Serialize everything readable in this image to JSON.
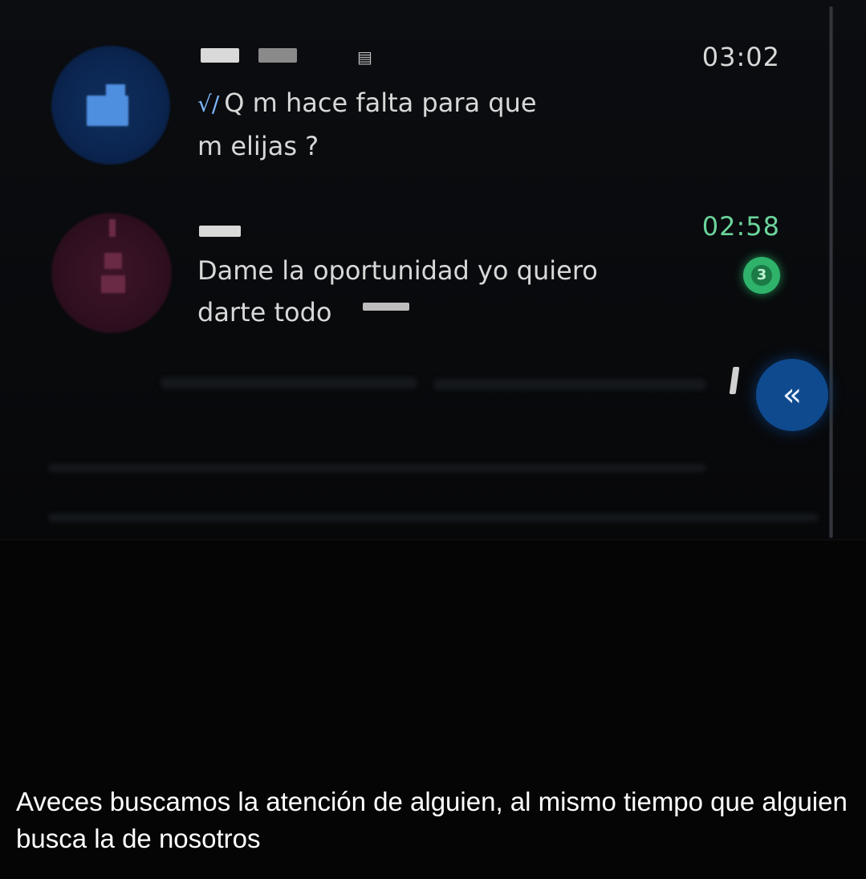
{
  "chats": [
    {
      "time": "03:02",
      "ticks": "√/",
      "message": "Q m hace falta para que\nm elijas ?",
      "avatar": "blue-avatar",
      "time_color": "#d8d8d8"
    },
    {
      "time": "02:58",
      "message": "Dame la oportunidad yo quiero\ndarte todo",
      "unread_count": "3",
      "avatar": "pink-avatar",
      "time_color": "#6bd49b"
    }
  ],
  "fab": {
    "icon": "double-chevron-left-icon",
    "glyph": "«"
  },
  "caption": "Aveces buscamos la atención de alguien, al mismo tiempo que alguien busca la de nosotros",
  "colors": {
    "background": "#050506",
    "accent_blue": "#0f4a8e",
    "badge_green": "#2fb26a",
    "ticks": "#7eb6ff"
  }
}
